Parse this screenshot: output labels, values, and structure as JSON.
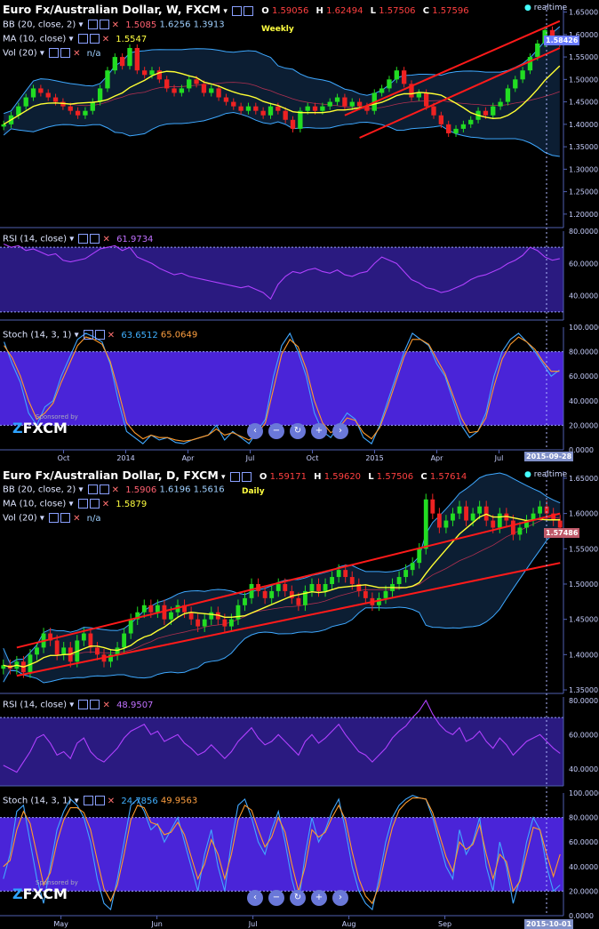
{
  "weekly": {
    "title": "Euro Fx/Australian Dollar, W, FXCM",
    "ohlc": {
      "o_label": "O",
      "o": "1.59056",
      "h_label": "H",
      "h": "1.62494",
      "l_label": "L",
      "l": "1.57506",
      "c_label": "C",
      "c": "1.57596"
    },
    "bb": {
      "label": "BB (20, close, 2)",
      "v1": "1.5085",
      "v2": "1.6256",
      "v3": "1.3913"
    },
    "ma": {
      "label": "MA (10, close)",
      "value": "1.5547"
    },
    "vol": {
      "label": "Vol (20)",
      "value": "n/a"
    },
    "tag": "Weekly",
    "realtime": "realtime",
    "price_tag": "1.58426",
    "rsi": {
      "label": "RSI (14, close)",
      "value": "61.9734"
    },
    "stoch": {
      "label": "Stoch (14, 3, 1)",
      "k": "63.6512",
      "d": "65.0649"
    },
    "date_tag": "2015-09-28",
    "sponsor": "Sponsored by",
    "brand": "FXCM"
  },
  "daily": {
    "title": "Euro Fx/Australian Dollar, D, FXCM",
    "ohlc": {
      "o_label": "O",
      "o": "1.59171",
      "h_label": "H",
      "h": "1.59620",
      "l_label": "L",
      "l": "1.57506",
      "c_label": "C",
      "c": "1.57614"
    },
    "bb": {
      "label": "BB (20, close, 2)",
      "v1": "1.5906",
      "v2": "1.6196",
      "v3": "1.5616"
    },
    "ma": {
      "label": "MA (10, close)",
      "value": "1.5879"
    },
    "vol": {
      "label": "Vol (20)",
      "value": "n/a"
    },
    "tag": "Daily",
    "realtime": "realtime",
    "price_tag": "1.57486",
    "rsi": {
      "label": "RSI (14, close)",
      "value": "48.9507"
    },
    "stoch": {
      "label": "Stoch (14, 3, 1)",
      "k": "24.7856",
      "d": "49.9563"
    },
    "date_tag": "2015-10-01",
    "sponsor": "Sponsored by",
    "brand": "FXCM"
  },
  "colors": {
    "bg": "#000000",
    "bb_fill": "#0c1e33",
    "bb_line": "#3ea8ff",
    "ma": "#ffff33",
    "bull": "#22dd22",
    "bear": "#ee2222",
    "channel": "#ff1a1a",
    "rsi": "#b040ff",
    "rsi_bg": "#2a1a80",
    "stoch_bg": "#4a24d8",
    "stoch_k": "#40a8ff",
    "stoch_d": "#ff9a2a"
  },
  "chart_data": [
    {
      "type": "candlestick",
      "name": "Weekly price",
      "xticks": [
        "Oct",
        "2014",
        "Apr",
        "Jul",
        "Oct",
        "2015",
        "Apr",
        "Jul"
      ],
      "yticks": [
        "1.65000",
        "1.60000",
        "1.55000",
        "1.50000",
        "1.45000",
        "1.40000",
        "1.35000",
        "1.30000",
        "1.25000",
        "1.20000"
      ],
      "ylim": [
        1.17,
        1.665
      ],
      "close": [
        1.4,
        1.42,
        1.44,
        1.46,
        1.48,
        1.47,
        1.46,
        1.45,
        1.44,
        1.43,
        1.42,
        1.43,
        1.45,
        1.48,
        1.52,
        1.55,
        1.53,
        1.57,
        1.52,
        1.51,
        1.52,
        1.5,
        1.48,
        1.47,
        1.48,
        1.5,
        1.49,
        1.47,
        1.48,
        1.46,
        1.45,
        1.44,
        1.43,
        1.44,
        1.43,
        1.42,
        1.44,
        1.43,
        1.41,
        1.39,
        1.43,
        1.44,
        1.43,
        1.44,
        1.45,
        1.46,
        1.44,
        1.45,
        1.44,
        1.43,
        1.47,
        1.48,
        1.5,
        1.52,
        1.49,
        1.46,
        1.47,
        1.44,
        1.42,
        1.4,
        1.38,
        1.39,
        1.4,
        1.41,
        1.43,
        1.42,
        1.44,
        1.45,
        1.48,
        1.5,
        1.52,
        1.55,
        1.58,
        1.61,
        1.59,
        1.58
      ]
    },
    {
      "type": "line",
      "name": "Weekly RSI",
      "ylim": [
        25,
        80
      ],
      "yticks": [
        "80.0000",
        "60.0000",
        "40.0000"
      ],
      "values": [
        72,
        70,
        71,
        68,
        69,
        67,
        65,
        66,
        62,
        61,
        62,
        63,
        66,
        69,
        70,
        71,
        68,
        70,
        64,
        62,
        60,
        57,
        55,
        53,
        54,
        52,
        51,
        50,
        49,
        48,
        47,
        46,
        45,
        46,
        44,
        42,
        38,
        47,
        52,
        55,
        54,
        56,
        57,
        55,
        54,
        56,
        53,
        52,
        54,
        55,
        60,
        64,
        62,
        60,
        55,
        50,
        48,
        45,
        44,
        42,
        43,
        45,
        47,
        50,
        52,
        53,
        55,
        57,
        60,
        62,
        65,
        70,
        68,
        64,
        62,
        63
      ]
    },
    {
      "type": "line",
      "name": "Weekly Stoch",
      "ylim": [
        0,
        100
      ],
      "yticks": [
        "100.0000",
        "80.0000",
        "60.0000",
        "40.0000",
        "20.0000",
        "0.0000"
      ],
      "k": [
        88,
        70,
        55,
        30,
        20,
        35,
        40,
        60,
        75,
        90,
        95,
        92,
        88,
        70,
        40,
        15,
        10,
        5,
        12,
        8,
        10,
        6,
        5,
        8,
        10,
        12,
        20,
        8,
        15,
        10,
        5,
        15,
        25,
        60,
        85,
        95,
        80,
        60,
        30,
        15,
        10,
        20,
        30,
        25,
        10,
        5,
        20,
        40,
        60,
        80,
        95,
        90,
        85,
        70,
        60,
        40,
        20,
        10,
        15,
        30,
        60,
        80,
        90,
        95,
        88,
        80,
        70,
        60,
        65
      ],
      "d": [
        85,
        75,
        60,
        40,
        25,
        30,
        38,
        55,
        70,
        85,
        92,
        90,
        86,
        72,
        48,
        22,
        14,
        9,
        12,
        10,
        10,
        8,
        7,
        8,
        10,
        12,
        17,
        12,
        14,
        11,
        8,
        13,
        22,
        50,
        78,
        90,
        84,
        66,
        40,
        22,
        14,
        18,
        26,
        24,
        14,
        9,
        18,
        36,
        56,
        76,
        90,
        90,
        86,
        74,
        62,
        44,
        26,
        14,
        15,
        26,
        52,
        74,
        86,
        92,
        88,
        82,
        72,
        64,
        64
      ]
    },
    {
      "type": "candlestick",
      "name": "Daily price",
      "xticks": [
        "May",
        "Jun",
        "Jul",
        "Aug",
        "Sep"
      ],
      "yticks": [
        "1.65000",
        "1.60000",
        "1.55000",
        "1.50000",
        "1.45000",
        "1.40000",
        "1.35000"
      ],
      "ylim": [
        1.345,
        1.66
      ],
      "close": [
        1.385,
        1.38,
        1.39,
        1.375,
        1.4,
        1.41,
        1.43,
        1.42,
        1.4,
        1.41,
        1.39,
        1.42,
        1.43,
        1.41,
        1.4,
        1.39,
        1.4,
        1.41,
        1.43,
        1.45,
        1.46,
        1.47,
        1.46,
        1.47,
        1.45,
        1.46,
        1.47,
        1.46,
        1.45,
        1.44,
        1.45,
        1.46,
        1.45,
        1.44,
        1.45,
        1.47,
        1.48,
        1.5,
        1.49,
        1.48,
        1.49,
        1.5,
        1.49,
        1.48,
        1.47,
        1.49,
        1.5,
        1.49,
        1.5,
        1.51,
        1.52,
        1.51,
        1.5,
        1.49,
        1.48,
        1.47,
        1.48,
        1.49,
        1.5,
        1.51,
        1.52,
        1.53,
        1.55,
        1.62,
        1.6,
        1.58,
        1.59,
        1.6,
        1.61,
        1.59,
        1.6,
        1.61,
        1.59,
        1.58,
        1.6,
        1.59,
        1.57,
        1.58,
        1.59,
        1.6,
        1.61,
        1.6,
        1.59,
        1.58
      ]
    },
    {
      "type": "line",
      "name": "Daily RSI",
      "ylim": [
        30,
        82
      ],
      "yticks": [
        "80.0000",
        "60.0000",
        "40.0000"
      ],
      "values": [
        42,
        40,
        38,
        44,
        50,
        58,
        60,
        55,
        48,
        50,
        46,
        55,
        58,
        50,
        46,
        44,
        48,
        52,
        58,
        62,
        64,
        66,
        60,
        62,
        56,
        58,
        60,
        55,
        52,
        48,
        50,
        54,
        50,
        46,
        50,
        56,
        60,
        64,
        58,
        54,
        56,
        60,
        56,
        52,
        48,
        56,
        60,
        55,
        58,
        62,
        66,
        60,
        55,
        50,
        48,
        44,
        48,
        52,
        58,
        62,
        65,
        70,
        74,
        80,
        72,
        66,
        62,
        60,
        64,
        56,
        58,
        62,
        56,
        52,
        58,
        54,
        48,
        52,
        56,
        58,
        60,
        56,
        52,
        49
      ]
    },
    {
      "type": "line",
      "name": "Daily Stoch",
      "ylim": [
        0,
        100
      ],
      "yticks": [
        "100.0000",
        "80.0000",
        "60.0000",
        "40.0000",
        "20.0000",
        "0.0000"
      ],
      "k": [
        30,
        50,
        85,
        90,
        60,
        30,
        10,
        40,
        70,
        85,
        95,
        90,
        80,
        60,
        30,
        10,
        5,
        30,
        60,
        90,
        95,
        85,
        70,
        75,
        60,
        70,
        80,
        60,
        40,
        20,
        50,
        70,
        40,
        20,
        60,
        90,
        95,
        80,
        60,
        50,
        70,
        85,
        60,
        30,
        10,
        50,
        80,
        60,
        70,
        85,
        95,
        70,
        40,
        20,
        10,
        5,
        30,
        60,
        80,
        90,
        95,
        98,
        96,
        95,
        80,
        60,
        40,
        30,
        70,
        50,
        60,
        80,
        40,
        20,
        60,
        40,
        10,
        30,
        60,
        80,
        70,
        40,
        20,
        25
      ],
      "d": [
        40,
        45,
        70,
        85,
        75,
        50,
        25,
        35,
        60,
        78,
        88,
        88,
        84,
        70,
        45,
        22,
        12,
        25,
        50,
        78,
        90,
        88,
        76,
        74,
        66,
        68,
        76,
        66,
        48,
        30,
        42,
        62,
        50,
        30,
        50,
        78,
        90,
        86,
        70,
        56,
        64,
        80,
        68,
        42,
        20,
        40,
        70,
        64,
        68,
        80,
        90,
        78,
        52,
        30,
        16,
        10,
        24,
        50,
        72,
        86,
        92,
        96,
        96,
        95,
        84,
        66,
        48,
        36,
        60,
        54,
        58,
        74,
        50,
        30,
        50,
        44,
        20,
        28,
        50,
        72,
        70,
        50,
        32,
        50
      ]
    }
  ]
}
